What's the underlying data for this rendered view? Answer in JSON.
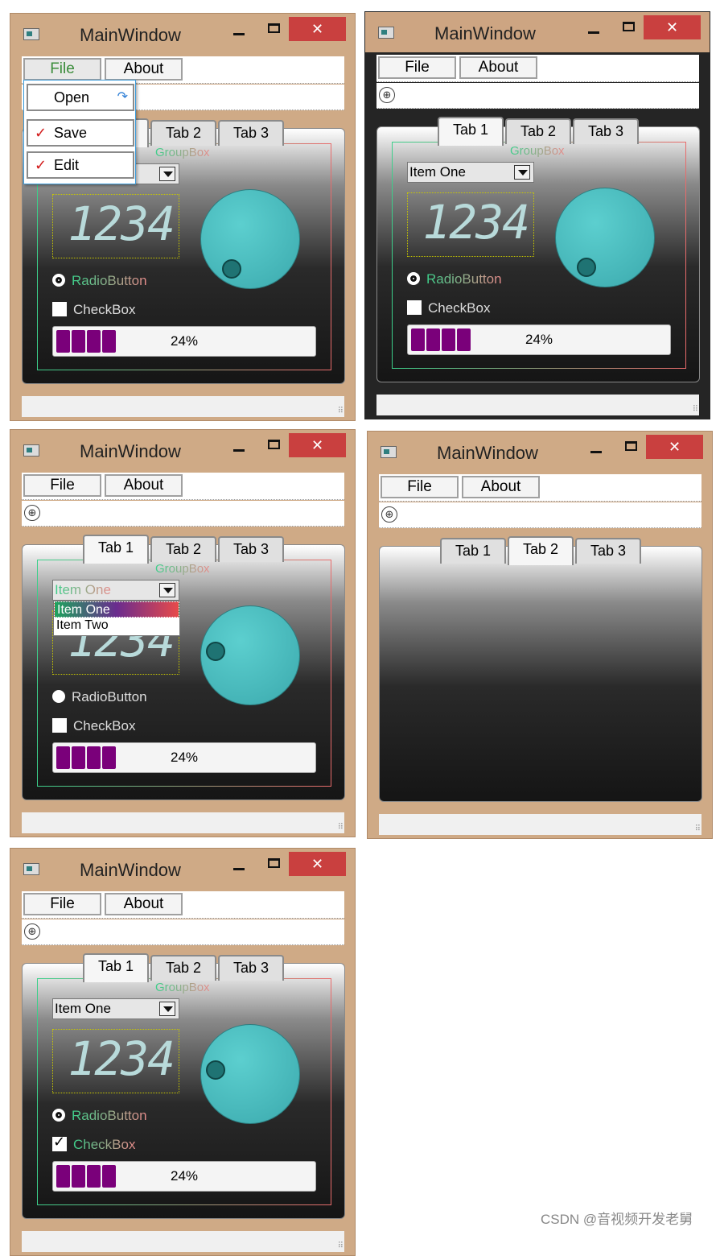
{
  "screens": [
    {
      "file_menu_open": true,
      "combo_open": false,
      "active_tab": 1,
      "radio_checked": true,
      "checkbox_checked": false,
      "show_content": true,
      "dial_dot": "bottom-left"
    },
    {
      "file_menu_open": false,
      "combo_open": false,
      "active_tab": 1,
      "radio_checked": true,
      "checkbox_checked": false,
      "show_content": true,
      "dial_dot": "bottom-left"
    },
    {
      "file_menu_open": false,
      "combo_open": true,
      "active_tab": 1,
      "radio_checked": false,
      "checkbox_checked": false,
      "show_content": true,
      "dial_dot": "left"
    },
    {
      "file_menu_open": false,
      "combo_open": false,
      "active_tab": 2,
      "show_content": false
    },
    {
      "file_menu_open": false,
      "combo_open": false,
      "active_tab": 1,
      "radio_checked": true,
      "checkbox_checked": true,
      "show_content": true,
      "dial_dot": "left"
    }
  ],
  "window": {
    "title": "MainWindow",
    "close_glyph": "✕"
  },
  "menu": {
    "file": "File",
    "about": "About",
    "items": [
      "Open",
      "Save",
      "Edit"
    ],
    "checked": [
      "Save",
      "Edit"
    ]
  },
  "tabs": [
    "Tab 1",
    "Tab 2",
    "Tab 3"
  ],
  "groupbox": {
    "title": "GroupBox"
  },
  "combo": {
    "value": "Item One",
    "options": [
      "Item One",
      "Item Two"
    ]
  },
  "lcd": {
    "value": "1234"
  },
  "radio": {
    "label": "RadioButton"
  },
  "checkbox": {
    "label": "CheckBox"
  },
  "progress": {
    "value": 24,
    "text": "24%",
    "chunks_filled": 4
  },
  "colors": {
    "frame": "#cfaa86",
    "close": "#c9403f",
    "progress_chunk": "#7a007a",
    "dial": "#4fc1c3"
  },
  "watermark": "CSDN @音视频开发老舅"
}
